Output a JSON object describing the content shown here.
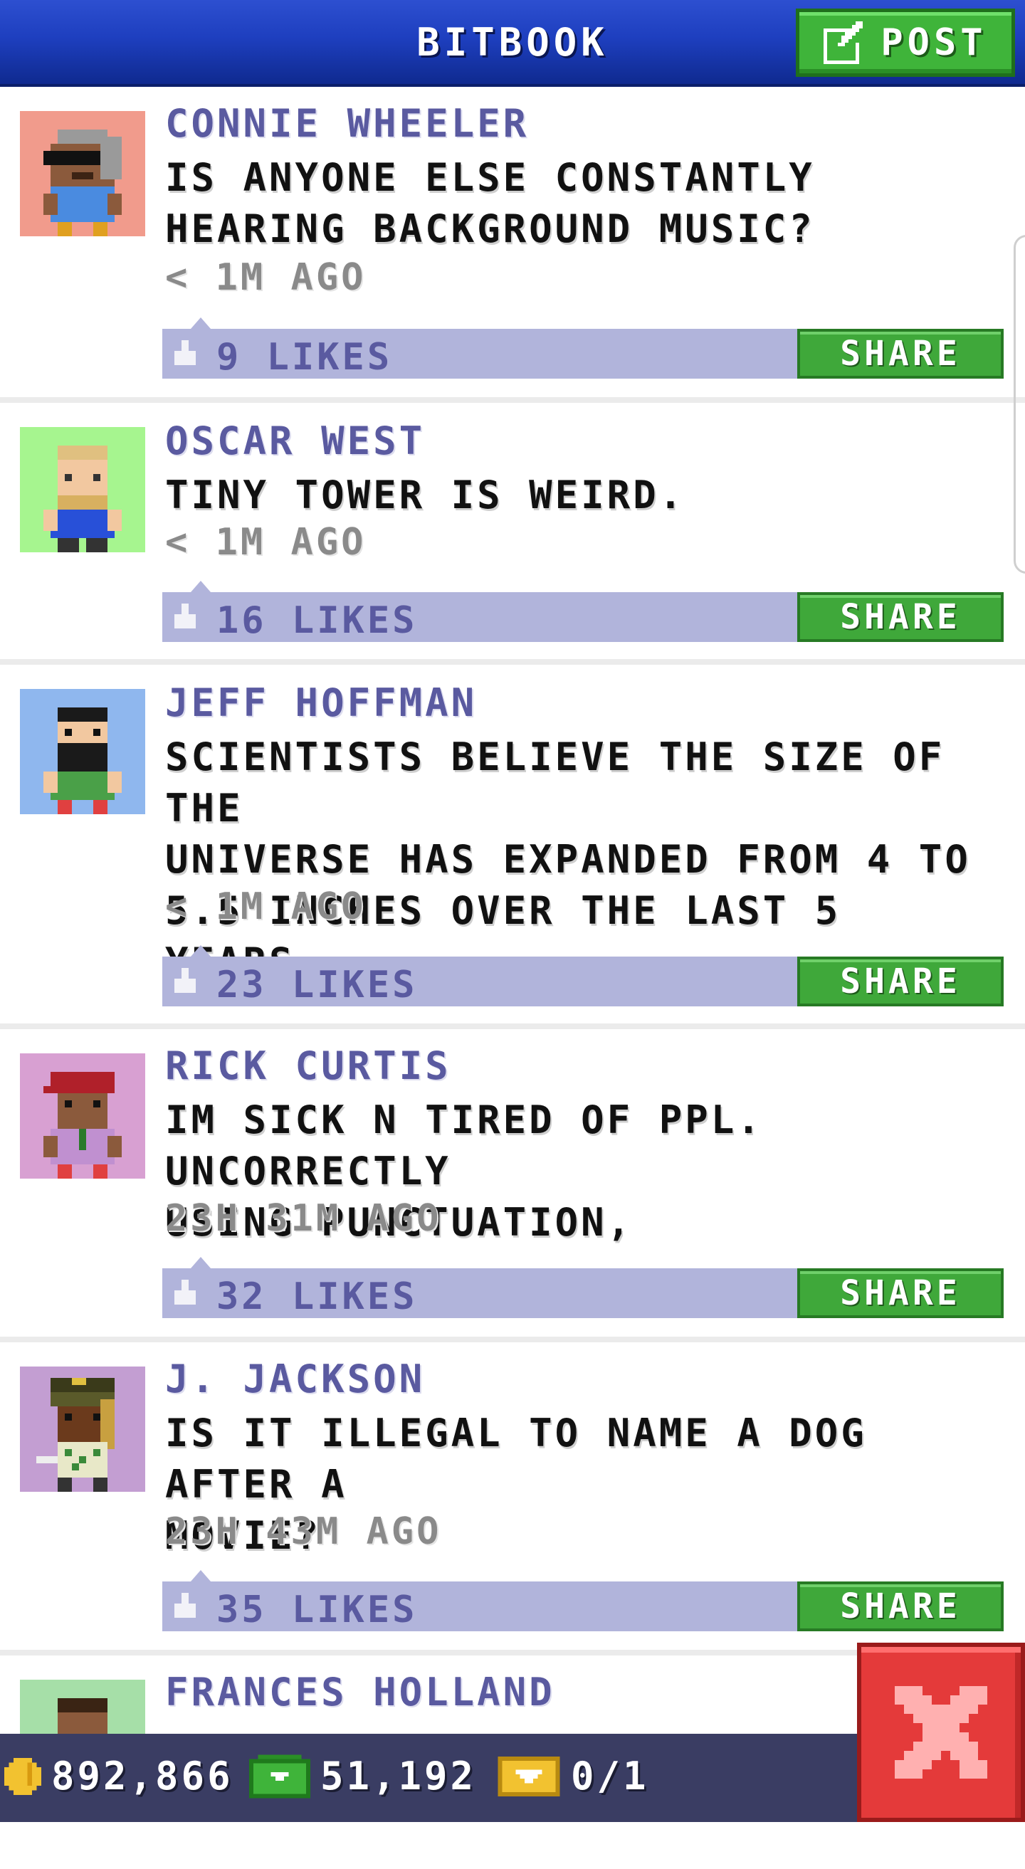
{
  "header": {
    "title": "BITBOOK",
    "post_label": "POST",
    "post_icon": "compose-icon"
  },
  "posts": [
    {
      "author": "CONNIE WHEELER",
      "message": "IS ANYONE ELSE CONSTANTLY\nHEARING BACKGROUND MUSIC?",
      "time": "< 1M AGO",
      "likes": "9 LIKES",
      "share": "SHARE",
      "avatar_bg": "#f19b8c"
    },
    {
      "author": "OSCAR WEST",
      "message": "TINY TOWER IS WEIRD.",
      "time": "< 1M AGO",
      "likes": "16 LIKES",
      "share": "SHARE",
      "avatar_bg": "#a6f58f"
    },
    {
      "author": "JEFF HOFFMAN",
      "message": "SCIENTISTS BELIEVE THE SIZE OF THE\nUNIVERSE HAS EXPANDED FROM 4 TO\n5.5 INCHES OVER THE LAST 5 YEARS.",
      "time": "< 1M AGO",
      "likes": "23 LIKES",
      "share": "SHARE",
      "avatar_bg": "#8fb7ee"
    },
    {
      "author": "RICK CURTIS",
      "message": "IM SICK N TIRED OF PPL. UNCORRECTLY\nUSING PUNCTUATION,",
      "time": "23H 31M AGO",
      "likes": "32 LIKES",
      "share": "SHARE",
      "avatar_bg": "#d8a0d2"
    },
    {
      "author": "J. JACKSON",
      "message": "IS IT ILLEGAL TO NAME A DOG AFTER A\nMOVIE?",
      "time": "23H 43M AGO",
      "likes": "35 LIKES",
      "share": "SHARE",
      "avatar_bg": "#c39ed2"
    },
    {
      "author": "FRANCES HOLLAND",
      "message": "",
      "time": "",
      "likes": "",
      "share": "",
      "avatar_bg": "#a6dfa8"
    }
  ],
  "status": {
    "coins": "892,866",
    "bux": "51,192",
    "tickets": "0/1"
  },
  "colors": {
    "header_blue": "#1e3fbf",
    "share_green": "#3fa83a",
    "likes_bar": "#b1b4db",
    "author_purple": "#5a5aa0",
    "close_red": "#e43a3a"
  }
}
